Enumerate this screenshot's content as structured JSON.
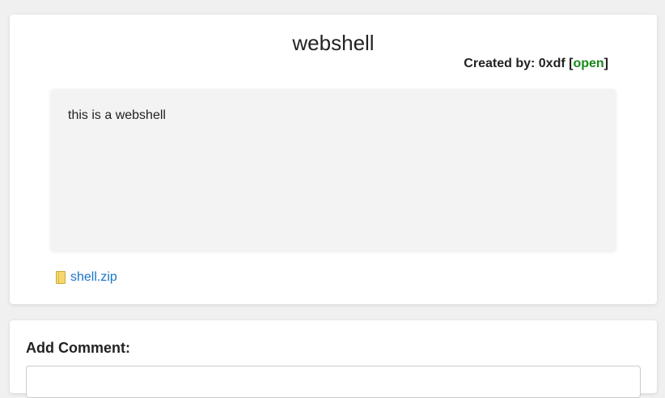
{
  "ticket": {
    "title": "webshell",
    "created_by_label": "Created by: ",
    "author": "0xdf",
    "status_open_bracket": "[",
    "status": "open",
    "status_close_bracket": "]",
    "status_color": "#1a8a1a",
    "body": "this is a webshell",
    "attachment": {
      "icon": "file-icon",
      "name": "shell.zip"
    }
  },
  "comment": {
    "label": "Add Comment:",
    "value": ""
  }
}
